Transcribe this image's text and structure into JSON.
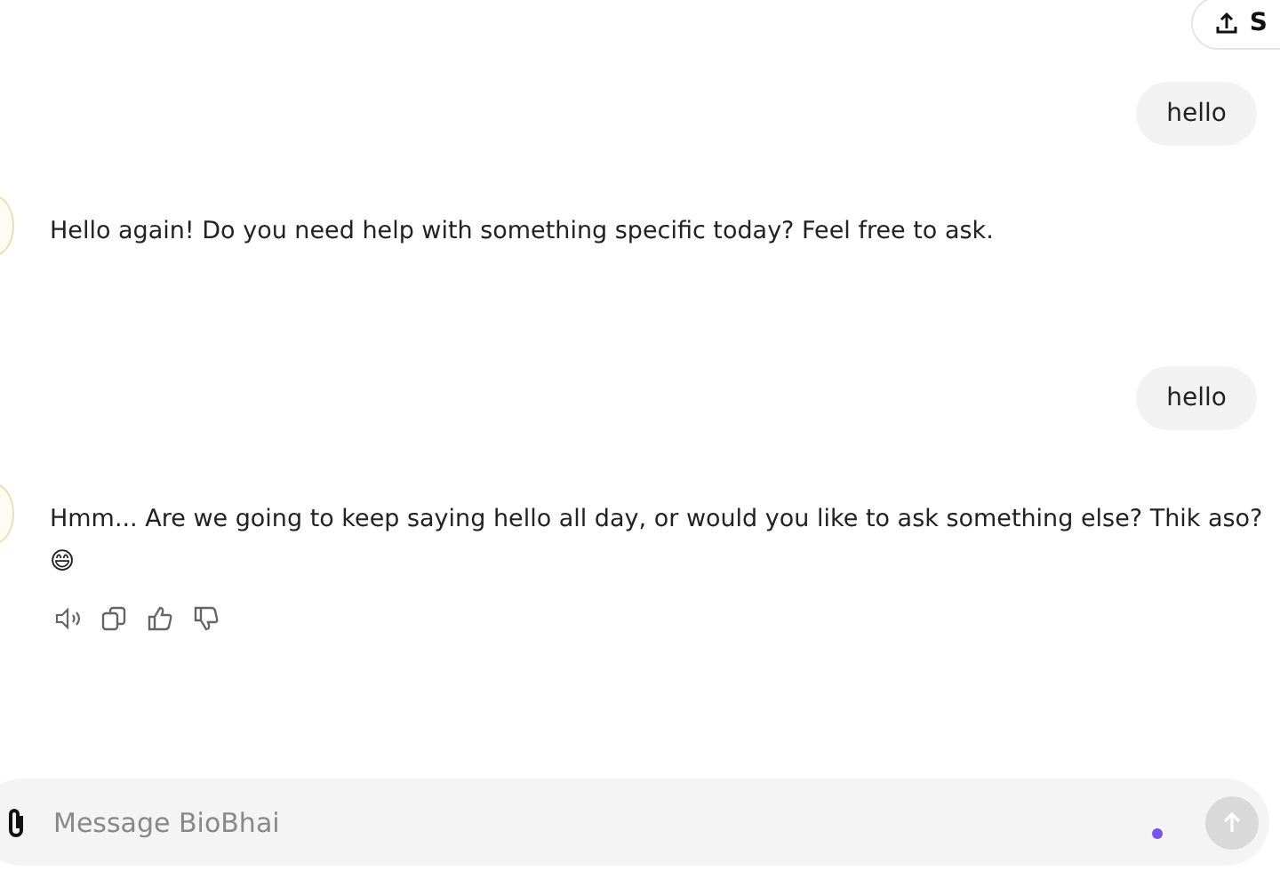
{
  "share_button": {
    "label": "S"
  },
  "messages": [
    {
      "kind": "user",
      "text": "hello"
    },
    {
      "kind": "assistant",
      "text": "Hello again! Do you need help with something specific today? Feel free to ask."
    },
    {
      "kind": "user",
      "text": "hello"
    },
    {
      "kind": "assistant_with_feedback",
      "text": "Hmm... Are we going to keep saying hello all day, or would you like to ask something else? Thik aso? 😄"
    }
  ],
  "composer": {
    "placeholder": "Message BioBhai"
  }
}
